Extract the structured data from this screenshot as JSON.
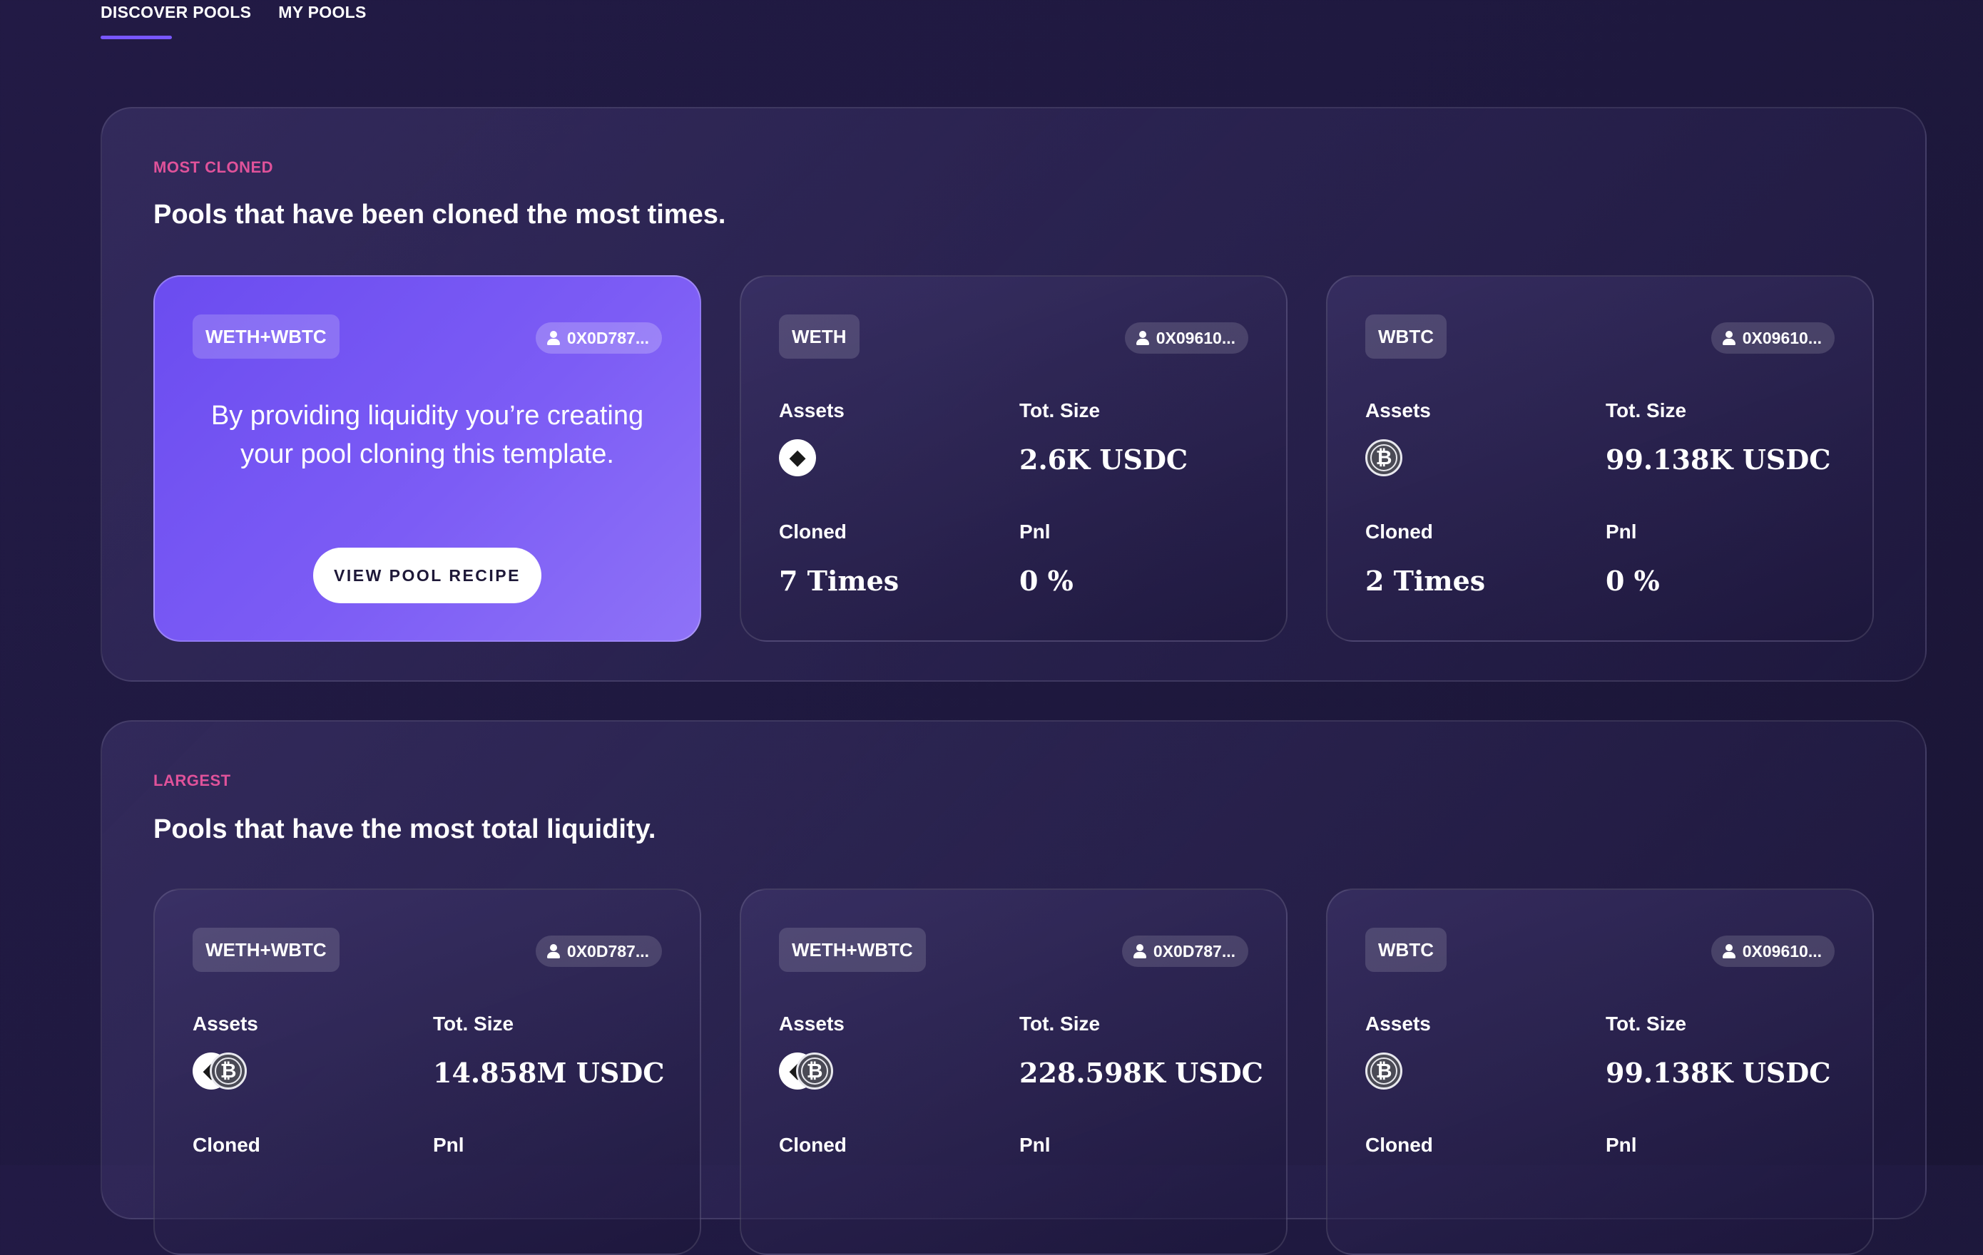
{
  "tabs": [
    "DISCOVER POOLS",
    "MY POOLS"
  ],
  "sections": [
    {
      "kicker": "MOST CLONED",
      "title": "Pools that have been cloned the most times.",
      "promo": {
        "name": "WETH+WBTC",
        "owner": "0X0D787...",
        "text": "By providing liquidity you’re creating your pool cloning this template.",
        "button": "VIEW POOL RECIPE"
      },
      "cards": [
        {
          "name": "WETH",
          "owner": "0X09610...",
          "assets_label": "Assets",
          "size_label": "Tot. Size",
          "size": "2.6K USDC",
          "cloned_label": "Cloned",
          "cloned": "7 Times",
          "pnl_label": "Pnl",
          "pnl": "0 %",
          "assets": [
            "eth"
          ]
        },
        {
          "name": "WBTC",
          "owner": "0X09610...",
          "assets_label": "Assets",
          "size_label": "Tot. Size",
          "size": "99.138K USDC",
          "cloned_label": "Cloned",
          "cloned": "2 Times",
          "pnl_label": "Pnl",
          "pnl": "0 %",
          "assets": [
            "btc"
          ]
        }
      ]
    },
    {
      "kicker": "LARGEST",
      "title": "Pools that have the most total liquidity.",
      "cards": [
        {
          "name": "WETH+WBTC",
          "owner": "0X0D787...",
          "assets_label": "Assets",
          "size_label": "Tot. Size",
          "size": "14.858M USDC",
          "cloned_label": "Cloned",
          "pnl_label": "Pnl",
          "assets": [
            "eth",
            "btc"
          ]
        },
        {
          "name": "WETH+WBTC",
          "owner": "0X0D787...",
          "assets_label": "Assets",
          "size_label": "Tot. Size",
          "size": "228.598K USDC",
          "cloned_label": "Cloned",
          "pnl_label": "Pnl",
          "assets": [
            "eth",
            "btc"
          ]
        },
        {
          "name": "WBTC",
          "owner": "0X09610...",
          "assets_label": "Assets",
          "size_label": "Tot. Size",
          "size": "99.138K USDC",
          "cloned_label": "Cloned",
          "pnl_label": "Pnl",
          "assets": [
            "btc"
          ]
        }
      ]
    }
  ],
  "colors": {
    "accent": "#7857ff",
    "kicker": "#e0529a",
    "background": "#1f1940",
    "promo": "#7c5cf5"
  }
}
